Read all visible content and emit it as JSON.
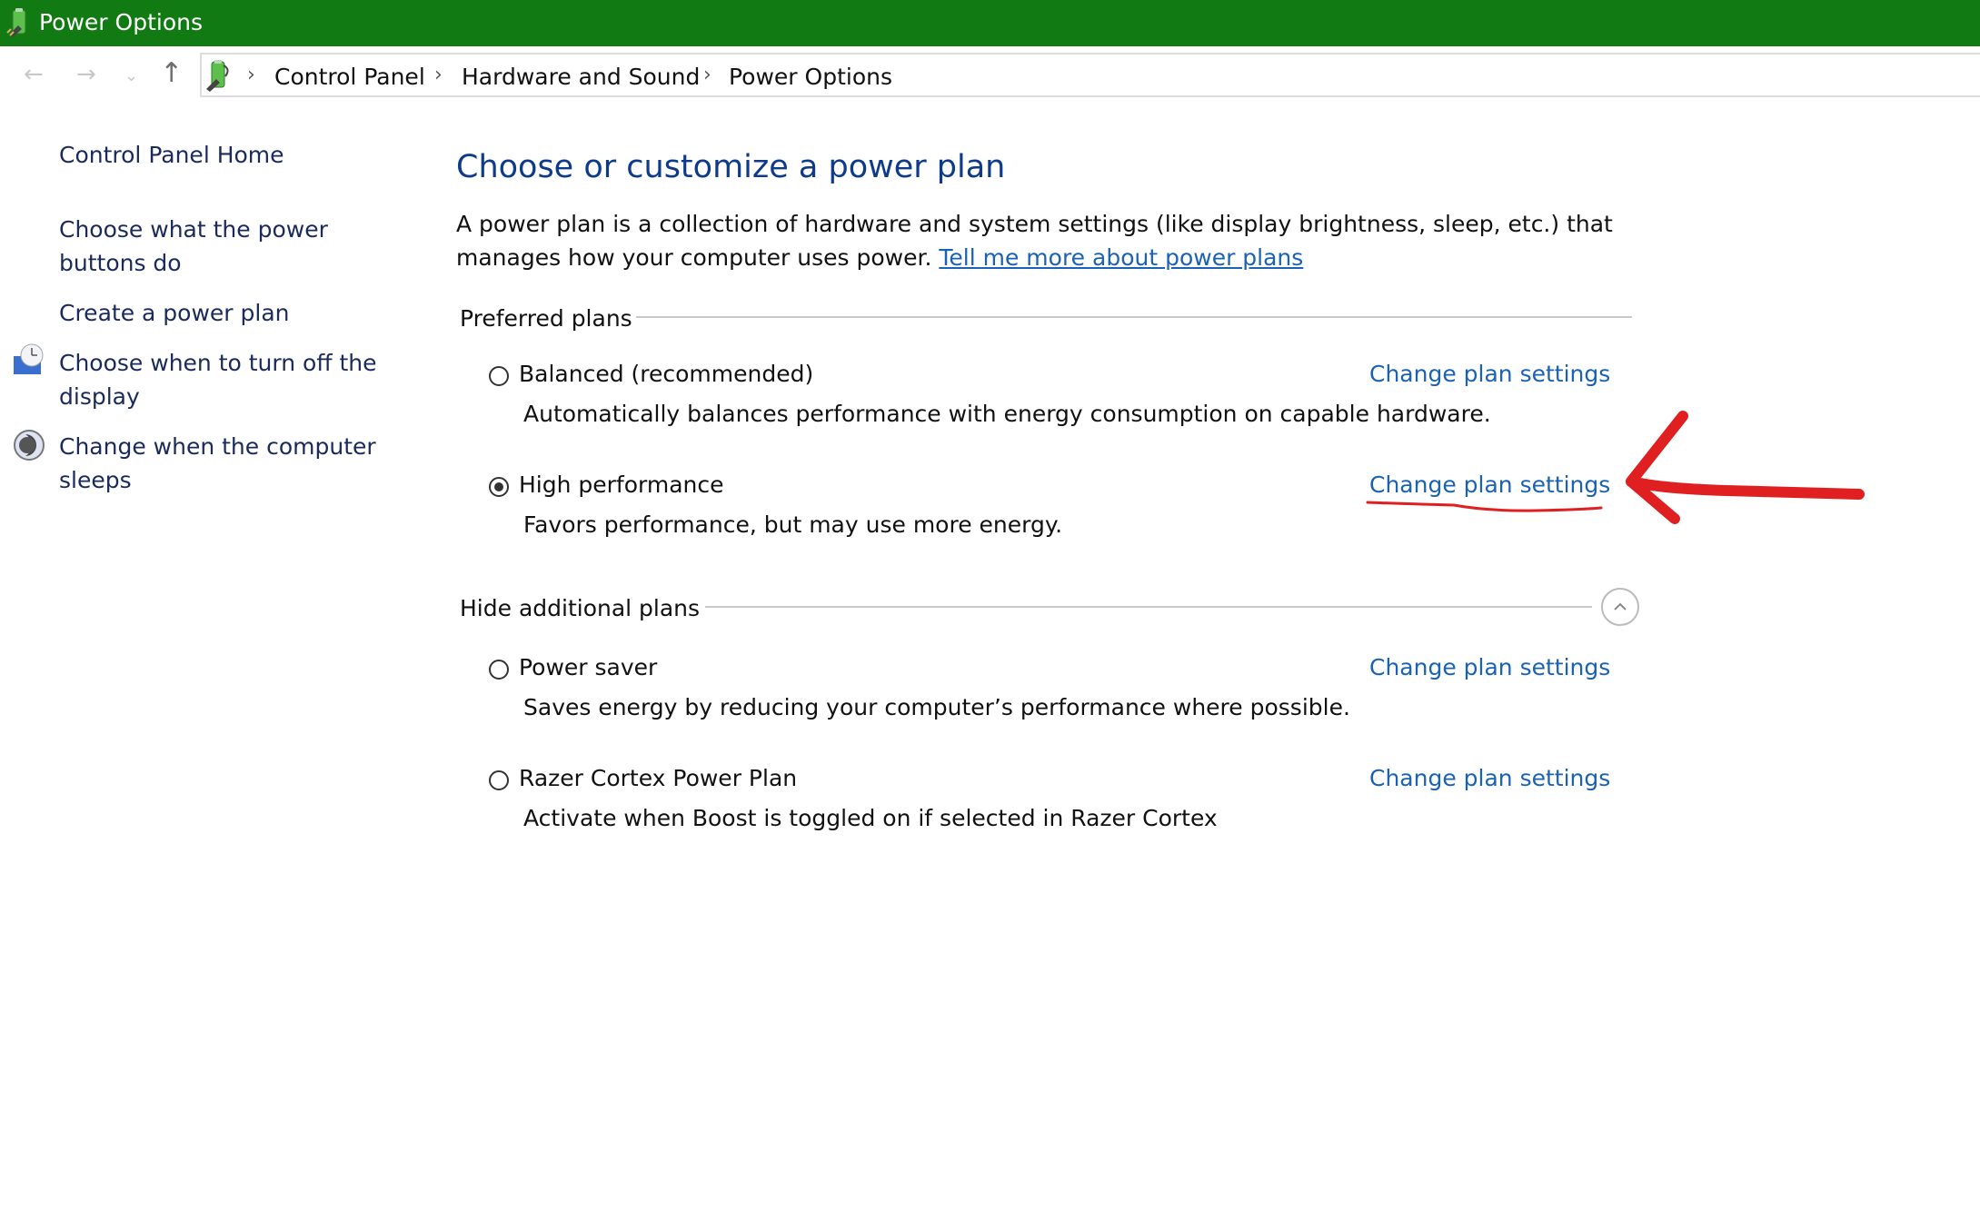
{
  "window": {
    "title": "Power Options",
    "title_bar_color": "#127a12"
  },
  "navigation": {
    "back_icon": "arrow-left-icon",
    "forward_icon": "arrow-right-icon",
    "recent_icon": "chevron-down-icon",
    "up_icon": "arrow-up-icon",
    "breadcrumb": [
      "Control Panel",
      "Hardware and Sound",
      "Power Options"
    ]
  },
  "sidebar": {
    "items": [
      {
        "label": "Control Panel Home",
        "icon": null
      },
      {
        "label": "Choose what the power buttons do",
        "icon": null
      },
      {
        "label": "Create a power plan",
        "icon": null
      },
      {
        "label": "Choose when to turn off the display",
        "icon": "display-clock-icon"
      },
      {
        "label": "Change when the computer sleeps",
        "icon": "moon-sleep-icon"
      }
    ]
  },
  "main": {
    "heading": "Choose or customize a power plan",
    "intro_text": "A power plan is a collection of hardware and system settings (like display brightness, sleep, etc.) that manages how your computer uses power. ",
    "intro_link": "Tell me more about power plans",
    "preferred_group_label": "Preferred plans",
    "additional_group_label": "Hide additional plans",
    "change_link_label": "Change plan settings",
    "link_color": "#1a62b5",
    "heading_color": "#0d3a8a",
    "plans": [
      {
        "name": "Balanced (recommended)",
        "description": "Automatically balances performance with energy consumption on capable hardware.",
        "selected": false
      },
      {
        "name": "High performance",
        "description": "Favors performance, but may use more energy.",
        "selected": true
      },
      {
        "name": "Power saver",
        "description": "Saves energy by reducing your computer’s performance where possible.",
        "selected": false
      },
      {
        "name": "Razer Cortex Power Plan",
        "description": "Activate when Boost is toggled on if selected in Razer Cortex",
        "selected": false
      }
    ]
  },
  "annotation": {
    "type": "red-arrow-and-underline",
    "target": "High performance - Change plan settings",
    "color": "#e02020"
  }
}
